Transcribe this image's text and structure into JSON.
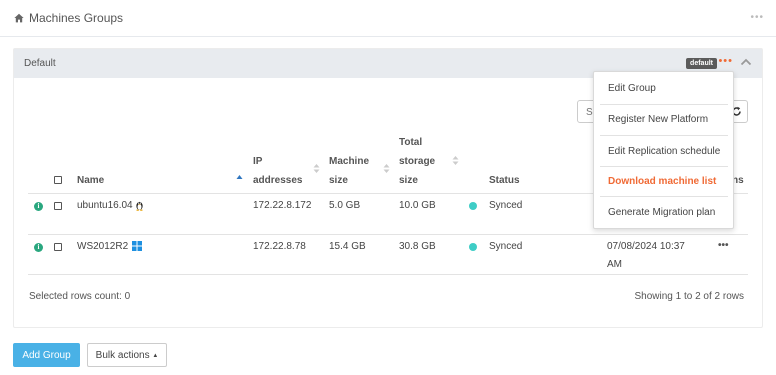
{
  "header": {
    "title": "Machines Groups",
    "menu_icon": "more-icon"
  },
  "group": {
    "name": "Default",
    "badge": "default",
    "menu": [
      "Edit Group",
      "Register New Platform",
      "Edit Replication schedule",
      "Download machine list",
      "Generate Migration plan"
    ]
  },
  "search": {
    "placeholder": "S"
  },
  "table": {
    "columns": {
      "name": "Name",
      "ip": [
        "IP",
        "addresses"
      ],
      "machine_size": [
        "Machine",
        "size"
      ],
      "storage": [
        "Total",
        "storage",
        "size"
      ],
      "status": "Status",
      "actions_partial": "ns"
    },
    "rows": [
      {
        "name": "ubuntu16.04",
        "os_icon": "linux-icon",
        "ip": "172.22.8.172",
        "machine_size": "5.0 GB",
        "storage": "10.0 GB",
        "status": "Synced",
        "date": [
          "",
          ""
        ]
      },
      {
        "name": "WS2012R2",
        "os_icon": "windows-icon",
        "ip": "172.22.8.78",
        "machine_size": "15.4 GB",
        "storage": "30.8 GB",
        "status": "Synced",
        "date": [
          "07/08/2024 10:37",
          "AM"
        ]
      }
    ]
  },
  "footer": {
    "selected": "Selected rows count: 0",
    "showing": "Showing 1 to 2 of 2 rows"
  },
  "buttons": {
    "add_group": "Add Group",
    "bulk_actions": "Bulk actions"
  },
  "colors": {
    "accent": "#49b1e6",
    "highlight": "#f06a35",
    "synced": "#3ecdc6",
    "info": "#2aa77f"
  }
}
